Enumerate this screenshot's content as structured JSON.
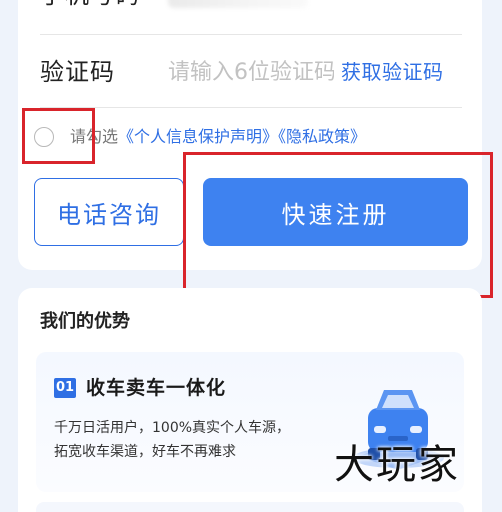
{
  "form": {
    "phone_label": "手机号码",
    "code_label": "验证码",
    "code_placeholder": "请输入6位验证码",
    "get_code_label": "获取验证码",
    "agree_prefix": "请勾选",
    "privacy_statement": "《个人信息保护声明》",
    "privacy_policy": "《隐私政策》",
    "consult_label": "电话咨询",
    "register_label": "快速注册"
  },
  "advantages": {
    "title": "我们的优势",
    "items": [
      {
        "number": "01",
        "title": "收车卖车一体化",
        "desc_line1": "千万日活用户，100%真实个人车源，",
        "desc_line2": "拓宽收车渠道，好车不再难求"
      }
    ]
  },
  "watermark": "大玩家",
  "colors": {
    "accent": "#2f6fe4",
    "button_bg": "#3e82f0",
    "highlight": "#d9242b"
  },
  "icons": {
    "checkbox": "circle-checkbox-icon",
    "car": "car-icon"
  }
}
